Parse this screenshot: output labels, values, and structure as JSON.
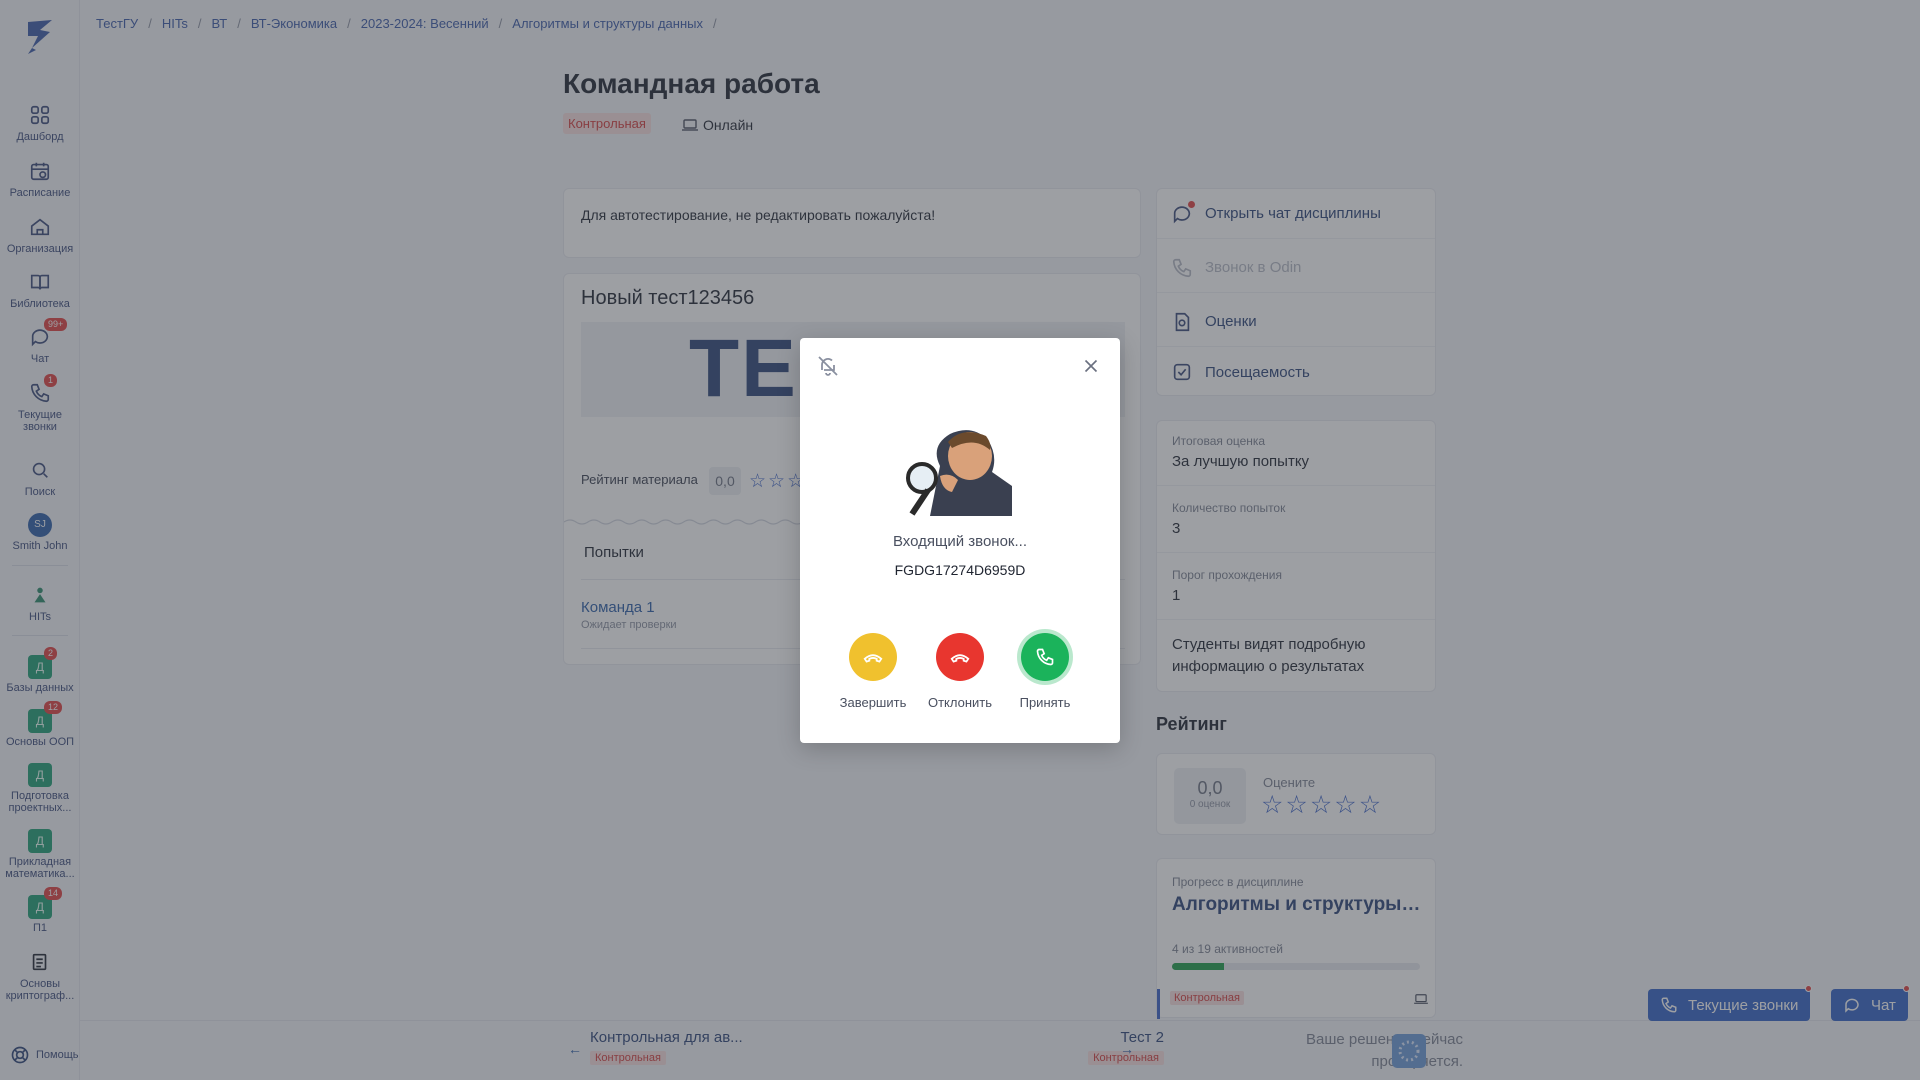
{
  "sidebar": {
    "items": [
      {
        "label": "Дашборд",
        "icon": "grid-icon"
      },
      {
        "label": "Расписание",
        "icon": "calendar-icon"
      },
      {
        "label": "Организация",
        "icon": "home-icon"
      },
      {
        "label": "Библиотека",
        "icon": "book-icon"
      },
      {
        "label": "Чат",
        "icon": "chat-icon",
        "badge": "99+"
      },
      {
        "label": "Текущие звонки",
        "icon": "phone-icon",
        "badge": "1"
      },
      {
        "label": "Поиск",
        "icon": "search-icon"
      },
      {
        "label": "Smith John",
        "avatar": "SJ"
      },
      {
        "label": "HITs",
        "icon": "hits-logo-icon"
      }
    ],
    "courses": [
      {
        "label": "Базы данных",
        "letter": "Д",
        "badge": "2"
      },
      {
        "label": "Основы ООП",
        "letter": "Д",
        "badge": "12"
      },
      {
        "label": "Подготовка проектных...",
        "letter": "Д"
      },
      {
        "label": "Прикладная математика...",
        "letter": "Д"
      },
      {
        "label": "П1",
        "letter": "Д",
        "badge": "14"
      },
      {
        "label": "Основы криптограф...",
        "icon": "document-icon"
      }
    ],
    "help": "Помощь"
  },
  "breadcrumb": [
    "ТестГУ",
    "HITs",
    "ВТ",
    "ВТ-Экономика",
    "2023-2024: Весенний",
    "Алгоритмы и структуры данных"
  ],
  "page": {
    "title": "Командная работа",
    "tag": "Контрольная",
    "mode": "Онлайн",
    "description": "Для автотестирование, не редактировать пожалуйста!"
  },
  "test": {
    "title": "Новый тест123456",
    "image_text": "ТЕС",
    "rating_label": "Рейтинг материала",
    "rating_value": "0,0",
    "attempts_header": "Попытки",
    "attempt_team": "Команда 1",
    "attempt_status": "Ожидает проверки"
  },
  "links": {
    "chat": "Открыть чат дисциплины",
    "call": "Звонок в Odin",
    "grades": "Оценки",
    "attendance": "Посещаемость"
  },
  "info": {
    "final_label": "Итоговая оценка",
    "final_value": "За лучшую попытку",
    "attempts_label": "Количество попыток",
    "attempts_value": "3",
    "threshold_label": "Порог прохождения",
    "threshold_value": "1",
    "students_info": "Студенты видят подробную информацию о результатах"
  },
  "rating": {
    "header": "Рейтинг",
    "value": "0,0",
    "count": "0 оценок",
    "prompt": "Оцените",
    "stars": 0
  },
  "progress": {
    "label": "Прогресс в дисциплине",
    "title": "Алгоритмы и структуры данных",
    "count": "4 из 19 активностей",
    "fraction": 0.21,
    "item_tag": "Контрольная"
  },
  "bottom": {
    "prev_label": "Контрольная для ав...",
    "prev_tag": "Контрольная",
    "next_label": "Тест 2",
    "next_tag": "Контрольная",
    "review": "Ваше решение сейчас проверяется.",
    "calls_button": "Текущие звонки",
    "chat_button": "Чат"
  },
  "call": {
    "status": "Входящий звонок...",
    "caller": "FGDG17274D6959D",
    "end_label": "Завершить",
    "decline_label": "Отклонить",
    "accept_label": "Принять"
  },
  "colors": {
    "accent": "#3262c6",
    "end": "#f0c12e",
    "decline": "#e8362f",
    "accept": "#1bb35b",
    "tag_bg": "#f9dede",
    "tag_text": "#d43c3c"
  }
}
